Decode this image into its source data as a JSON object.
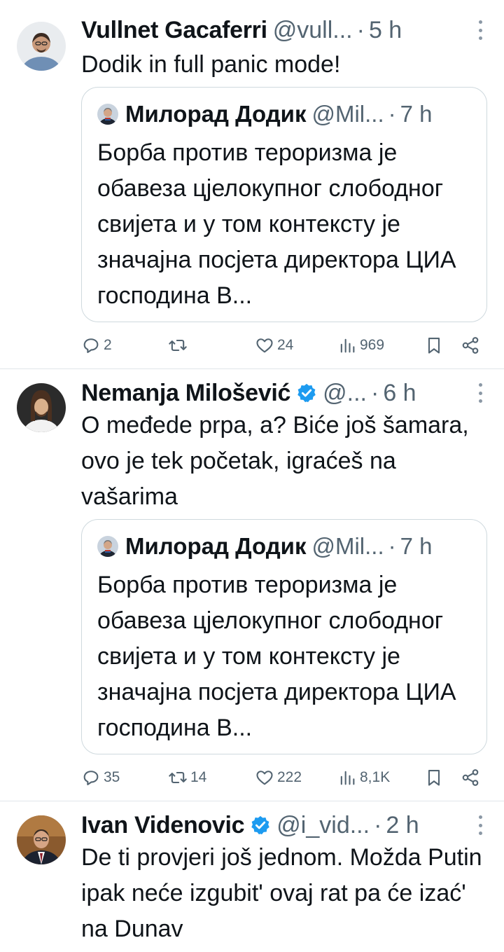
{
  "tweets": [
    {
      "author": "Vullnet Gacaferri",
      "handle": "@vull...",
      "dot": "·",
      "time": "5 h",
      "text": "Dodik in full panic mode!",
      "quote": {
        "author": "Милорад Додик",
        "handle": "@Mil...",
        "dot": "·",
        "time": "7 h",
        "text": "Борба против тероризма је обавеза цјелокупног слободног свијета и у том контексту је значајна посјета директора ЦИА господина В..."
      },
      "replies": "2",
      "retweets": "",
      "likes": "24",
      "views": "969"
    },
    {
      "author": "Nemanja Milošević",
      "handle": "@...",
      "dot": "·",
      "time": "6 h",
      "text": "O međede prpa, a? Biće još šamara, ovo je tek početak, igraćeš na vašarima",
      "quote": {
        "author": "Милорад Додик",
        "handle": "@Mil...",
        "dot": "·",
        "time": "7 h",
        "text": "Борба против тероризма је обавеза цјелокупног слободног свијета и у том контексту је значајна посјета директора ЦИА господина В..."
      },
      "replies": "35",
      "retweets": "14",
      "likes": "222",
      "views": "8,1K"
    },
    {
      "author": "Ivan Videnovic",
      "handle": "@i_vid...",
      "dot": "·",
      "time": "2 h",
      "text": "De ti provjeri još jednom. Možda Putin ipak neće izgubit' ovaj rat pa će izać' na Dunav"
    }
  ],
  "colors": {
    "verified": "#1d9bf0",
    "secondary_text": "#536471",
    "border": "#cfd9de"
  }
}
